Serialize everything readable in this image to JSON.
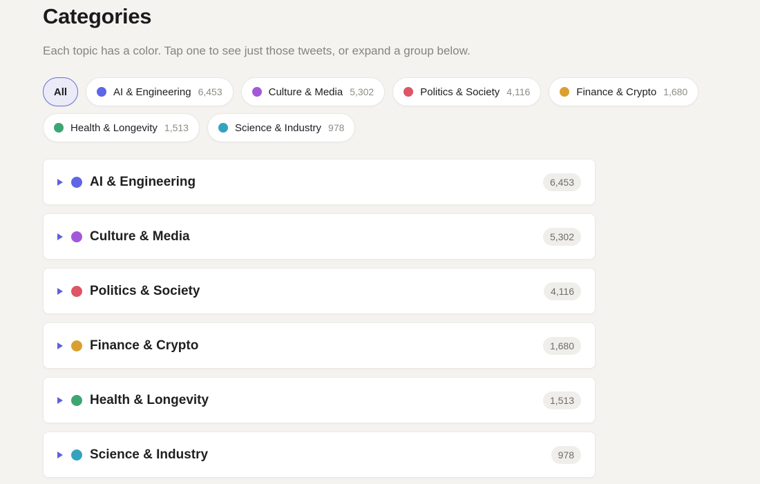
{
  "header": {
    "title": "Categories",
    "subtitle": "Each topic has a color. Tap one to see just those tweets, or expand a group below."
  },
  "filters": {
    "all_label": "All",
    "chips": [
      {
        "label": "AI & Engineering",
        "count": "6,453",
        "color": "#5f66e6"
      },
      {
        "label": "Culture & Media",
        "count": "5,302",
        "color": "#a259d9"
      },
      {
        "label": "Politics & Society",
        "count": "4,116",
        "color": "#de5565"
      },
      {
        "label": "Finance & Crypto",
        "count": "1,680",
        "color": "#d9a030"
      },
      {
        "label": "Health & Longevity",
        "count": "1,513",
        "color": "#3ea672"
      },
      {
        "label": "Science & Industry",
        "count": "978",
        "color": "#34a3bf"
      }
    ]
  },
  "groups": [
    {
      "label": "AI & Engineering",
      "count": "6,453",
      "color": "#5f66e6"
    },
    {
      "label": "Culture & Media",
      "count": "5,302",
      "color": "#a259d9"
    },
    {
      "label": "Politics & Society",
      "count": "4,116",
      "color": "#de5565"
    },
    {
      "label": "Finance & Crypto",
      "count": "1,680",
      "color": "#d9a030"
    },
    {
      "label": "Health & Longevity",
      "count": "1,513",
      "color": "#3ea672"
    },
    {
      "label": "Science & Industry",
      "count": "978",
      "color": "#34a3bf"
    }
  ]
}
